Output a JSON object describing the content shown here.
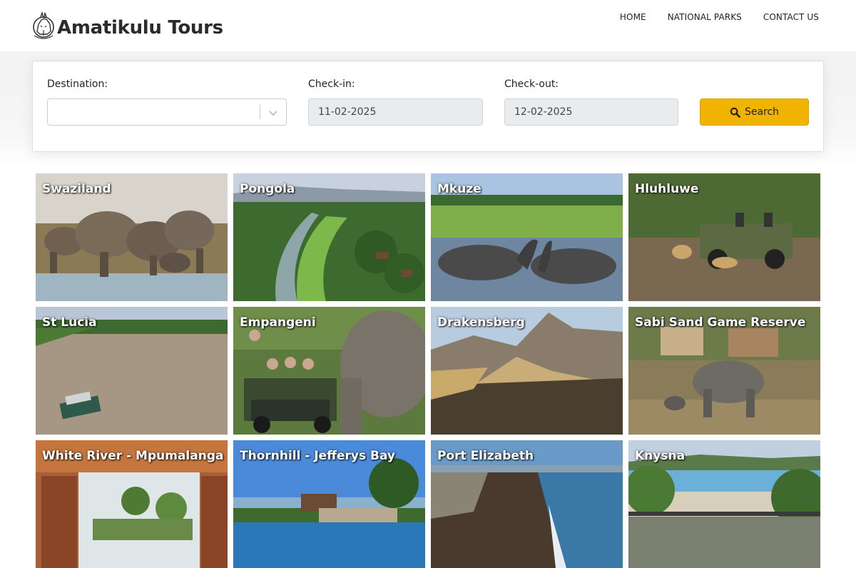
{
  "brand": {
    "name": "Amatikulu Tours",
    "logo_icon": "rhino-icon"
  },
  "nav": [
    {
      "label": "HOME"
    },
    {
      "label": "NATIONAL PARKS"
    },
    {
      "label": "CONTACT US"
    }
  ],
  "search": {
    "destination_label": "Destination:",
    "destination_value": "",
    "checkin_label": "Check-in:",
    "checkin_value": "11-02-2025",
    "checkout_label": "Check-out:",
    "checkout_value": "12-02-2025",
    "button_label": "Search",
    "button_icon": "search-icon",
    "accent_color": "#f0b400"
  },
  "destinations": [
    {
      "name": "Swaziland"
    },
    {
      "name": "Pongola"
    },
    {
      "name": "Mkuze"
    },
    {
      "name": "Hluhluwe"
    },
    {
      "name": "St Lucia"
    },
    {
      "name": "Empangeni"
    },
    {
      "name": "Drakensberg"
    },
    {
      "name": "Sabi Sand Game Reserve"
    },
    {
      "name": "White River - Mpumalanga"
    },
    {
      "name": "Thornhill - Jefferys Bay"
    },
    {
      "name": "Port Elizabeth"
    },
    {
      "name": "Knysna"
    }
  ]
}
